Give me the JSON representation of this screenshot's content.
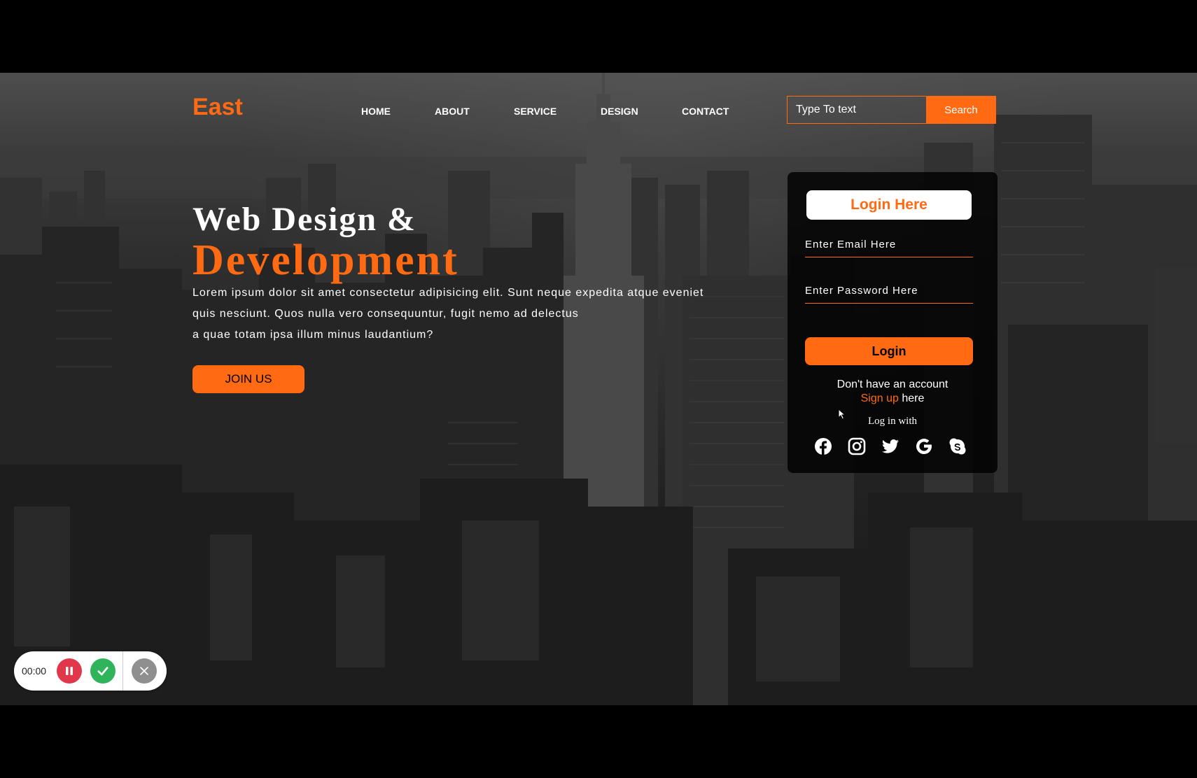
{
  "logo": "East",
  "nav": [
    "HOME",
    "ABOUT",
    "SERVICE",
    "DESIGN",
    "CONTACT"
  ],
  "search": {
    "placeholder": "Type To text",
    "button": "Search"
  },
  "hero": {
    "title_line1": "Web Design &",
    "title_line2": "Development",
    "paragraph_lines": [
      "Lorem ipsum dolor sit amet consectetur adipisicing elit. Sunt neque expedita atque eveniet",
      "quis nesciunt. Quos nulla vero consequuntur, fugit nemo ad delectus",
      "a quae totam ipsa illum minus laudantium?"
    ],
    "cta": "JOIN US"
  },
  "login_card": {
    "title": "Login Here",
    "email_placeholder": "Enter Email Here",
    "password_placeholder": "Enter Password Here",
    "login_button": "Login",
    "no_account": "Don't have an account",
    "signup_link": "Sign up",
    "signup_suffix": " here",
    "login_with": "Log in with",
    "social_icons": [
      "facebook-icon",
      "instagram-icon",
      "twitter-icon",
      "google-icon",
      "skype-icon"
    ]
  },
  "recorder": {
    "time": "00:00"
  },
  "colors": {
    "accent": "#ff6a13",
    "card_bg": "#0b0b0b",
    "text": "#ffffff"
  }
}
